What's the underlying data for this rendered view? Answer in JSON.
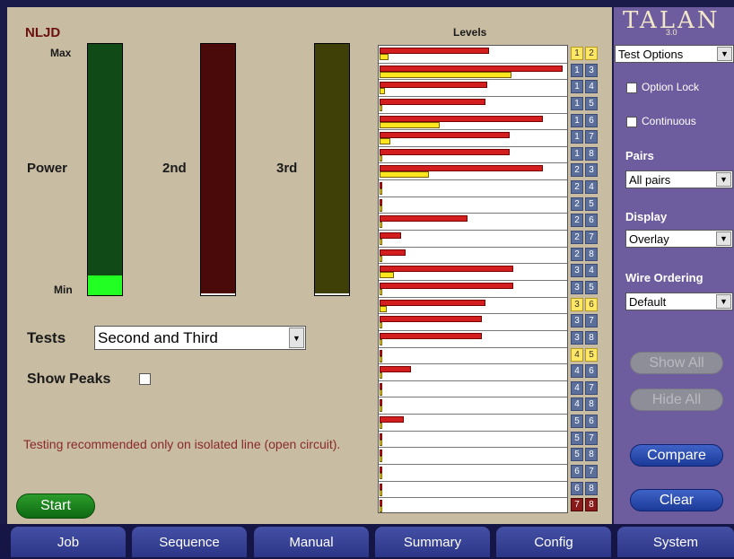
{
  "left": {
    "nljd_title": "NLJD",
    "max_label": "Max",
    "min_label": "Min",
    "power_label": "Power",
    "second_label": "2nd",
    "third_label": "3rd",
    "power_level": 0.08,
    "second_level": 0.0,
    "third_level": 0.0,
    "tests_label": "Tests",
    "tests_value": "Second and Third",
    "show_peaks_label": "Show Peaks",
    "warning": "Testing recommended only on isolated line (open circuit).",
    "start_label": "Start"
  },
  "levels": {
    "title": "Levels",
    "rows": [
      {
        "a": "1",
        "b": "2",
        "red": 0.6,
        "yel": 0.05,
        "hl": "both"
      },
      {
        "a": "1",
        "b": "3",
        "red": 1.0,
        "yel": 0.72,
        "hl": ""
      },
      {
        "a": "1",
        "b": "4",
        "red": 0.59,
        "yel": 0.03,
        "hl": ""
      },
      {
        "a": "1",
        "b": "5",
        "red": 0.58,
        "yel": 0.0,
        "hl": ""
      },
      {
        "a": "1",
        "b": "6",
        "red": 0.89,
        "yel": 0.33,
        "hl": ""
      },
      {
        "a": "1",
        "b": "7",
        "red": 0.71,
        "yel": 0.06,
        "hl": ""
      },
      {
        "a": "1",
        "b": "8",
        "red": 0.71,
        "yel": 0.0,
        "hl": ""
      },
      {
        "a": "2",
        "b": "3",
        "red": 0.89,
        "yel": 0.27,
        "hl": ""
      },
      {
        "a": "2",
        "b": "4",
        "red": 0.01,
        "yel": 0.0,
        "hl": ""
      },
      {
        "a": "2",
        "b": "5",
        "red": 0.0,
        "yel": 0.0,
        "hl": ""
      },
      {
        "a": "2",
        "b": "6",
        "red": 0.48,
        "yel": 0.0,
        "hl": ""
      },
      {
        "a": "2",
        "b": "7",
        "red": 0.12,
        "yel": 0.0,
        "hl": ""
      },
      {
        "a": "2",
        "b": "8",
        "red": 0.14,
        "yel": 0.0,
        "hl": ""
      },
      {
        "a": "3",
        "b": "4",
        "red": 0.73,
        "yel": 0.08,
        "hl": ""
      },
      {
        "a": "3",
        "b": "5",
        "red": 0.73,
        "yel": 0.0,
        "hl": ""
      },
      {
        "a": "3",
        "b": "6",
        "red": 0.58,
        "yel": 0.04,
        "hl": "both"
      },
      {
        "a": "3",
        "b": "7",
        "red": 0.56,
        "yel": 0.01,
        "hl": ""
      },
      {
        "a": "3",
        "b": "8",
        "red": 0.56,
        "yel": 0.0,
        "hl": ""
      },
      {
        "a": "4",
        "b": "5",
        "red": 0.01,
        "yel": 0.0,
        "hl": "both"
      },
      {
        "a": "4",
        "b": "6",
        "red": 0.17,
        "yel": 0.0,
        "hl": ""
      },
      {
        "a": "4",
        "b": "7",
        "red": 0.01,
        "yel": 0.0,
        "hl": ""
      },
      {
        "a": "4",
        "b": "8",
        "red": 0.01,
        "yel": 0.0,
        "hl": ""
      },
      {
        "a": "5",
        "b": "6",
        "red": 0.13,
        "yel": 0.0,
        "hl": ""
      },
      {
        "a": "5",
        "b": "7",
        "red": 0.01,
        "yel": 0.0,
        "hl": ""
      },
      {
        "a": "5",
        "b": "8",
        "red": 0.01,
        "yel": 0.0,
        "hl": ""
      },
      {
        "a": "6",
        "b": "7",
        "red": 0.01,
        "yel": 0.0,
        "hl": ""
      },
      {
        "a": "6",
        "b": "8",
        "red": 0.01,
        "yel": 0.0,
        "hl": ""
      },
      {
        "a": "7",
        "b": "8",
        "red": 0.01,
        "yel": 0.0,
        "hl": "red"
      }
    ]
  },
  "sidebar": {
    "logo": "TALAN",
    "version": "3.0",
    "options_value": "Test Options",
    "option_lock_label": "Option Lock",
    "continuous_label": "Continuous",
    "pairs_label": "Pairs",
    "pairs_value": "All pairs",
    "display_label": "Display",
    "display_value": "Overlay",
    "wire_ordering_label": "Wire Ordering",
    "wire_ordering_value": "Default",
    "show_all_label": "Show All",
    "hide_all_label": "Hide All",
    "compare_label": "Compare",
    "clear_label": "Clear"
  },
  "nav": [
    "Job",
    "Sequence",
    "Manual",
    "Summary",
    "Config",
    "System"
  ],
  "colors": {
    "power_meter": "#0f4a17",
    "power_fill": "#22ff22",
    "second_meter": "#4a0a0a",
    "third_meter": "#3f3f08",
    "red_bar": "#d21e1e",
    "yellow_bar": "#ffe61e"
  }
}
